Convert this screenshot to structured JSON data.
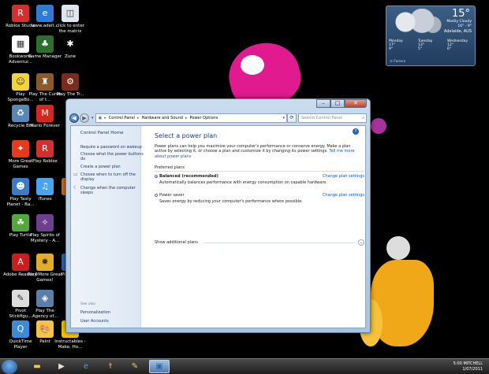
{
  "desktop_icons": [
    {
      "label": "Roblox Studio",
      "color": "#d32f2f",
      "glyph": "R"
    },
    {
      "label": "www.adelt...",
      "color": "#2e7bd6",
      "glyph": "e"
    },
    {
      "label": "click to enter the matrix",
      "color": "#dfe6ee",
      "glyph": "◫"
    },
    {
      "label": "Bookworm Adventur...",
      "color": "#ffffff",
      "glyph": "▦"
    },
    {
      "label": "Game Manager",
      "color": "#2c6e2c",
      "glyph": "♣"
    },
    {
      "label": "Zune",
      "color": "#000000",
      "glyph": "✱"
    },
    {
      "label": "Play SpongeBo...",
      "color": "#f3d53a",
      "glyph": "☺"
    },
    {
      "label": "Play The Curse of t...",
      "color": "#8b5a2b",
      "glyph": "♜"
    },
    {
      "label": "Play The Tr...",
      "color": "#7a2b1f",
      "glyph": "⚙"
    },
    {
      "label": "Recycle Bin",
      "color": "#5a86b8",
      "glyph": "♻"
    },
    {
      "label": "Mario Forever",
      "color": "#d7261e",
      "glyph": "M"
    },
    {
      "label": "More Great Games",
      "color": "#e63a1d",
      "glyph": "✦"
    },
    {
      "label": "Play Roblox",
      "color": "#d32f2f",
      "glyph": "R"
    },
    {
      "label": "Play Tasty Planet - Ba...",
      "color": "#3a7bc8",
      "glyph": "☻"
    },
    {
      "label": "iTunes",
      "color": "#4aa3ef",
      "glyph": "♫"
    },
    {
      "label": "Tre...",
      "color": "#c26d2a",
      "glyph": "✿"
    },
    {
      "label": "Play Turtix",
      "color": "#53a83b",
      "glyph": "☘"
    },
    {
      "label": "Play Spirits of Mystery - A...",
      "color": "#6d3f8f",
      "glyph": "✧"
    },
    {
      "label": "Adobe Reader 9",
      "color": "#c51f1f",
      "glyph": "A"
    },
    {
      "label": "Play More Great Games!",
      "color": "#e2ad2b",
      "glyph": "✸"
    },
    {
      "label": "Pi... In...",
      "color": "#3461a5",
      "glyph": "◉"
    },
    {
      "label": "Pivot Stickfigu...",
      "color": "#dddddd",
      "glyph": "✎"
    },
    {
      "label": "Play The Agency of...",
      "color": "#5b7fa8",
      "glyph": "◈"
    },
    {
      "label": "QuickTime Player",
      "color": "#3f8ad6",
      "glyph": "Q"
    },
    {
      "label": "Paint",
      "color": "#f4c44a",
      "glyph": "🎨"
    },
    {
      "label": "Instructables - Make, Ho...",
      "color": "#f5c400",
      "glyph": "☺"
    }
  ],
  "weather": {
    "temp": "15°",
    "condition": "Mostly Cloudy",
    "hi_lo": "16° - 9°",
    "location": "Adelaide, AUS",
    "days": [
      {
        "name": "Monday",
        "hi": "17°",
        "lo": "9°"
      },
      {
        "name": "Tuesday",
        "hi": "13°",
        "lo": "5°"
      },
      {
        "name": "Wednesday",
        "hi": "12°",
        "lo": "6°"
      }
    ],
    "provider": "Foreca"
  },
  "window": {
    "breadcrumb": [
      "Control Panel",
      "Hardware and Sound",
      "Power Options"
    ],
    "search_placeholder": "Search Control Panel",
    "sidebar": {
      "home": "Control Panel Home",
      "links": [
        "Require a password on wakeup",
        "Choose what the power buttons do",
        "Create a power plan",
        "Choose when to turn off the display",
        "Change when the computer sleeps"
      ],
      "see_also_title": "See also",
      "see_also": [
        "Personalization",
        "User Accounts"
      ]
    },
    "main": {
      "title": "Select a power plan",
      "intro": "Power plans can help you maximize your computer's performance or conserve energy. Make a plan active by selecting it, or choose a plan and customize it by changing its power settings.",
      "intro_link": "Tell me more about power plans",
      "preferred_label": "Preferred plans",
      "plans": [
        {
          "name": "Balanced (recommended)",
          "desc": "Automatically balances performance with energy consumption on capable hardware.",
          "change": "Change plan settings",
          "selected": true
        },
        {
          "name": "Power saver",
          "desc": "Saves energy by reducing your computer's performance where possible.",
          "change": "Change plan settings",
          "selected": false
        }
      ],
      "show_additional": "Show additional plans"
    }
  },
  "taskbar": {
    "time": "5:00 MITCHELL",
    "date": "1/07/2011"
  }
}
